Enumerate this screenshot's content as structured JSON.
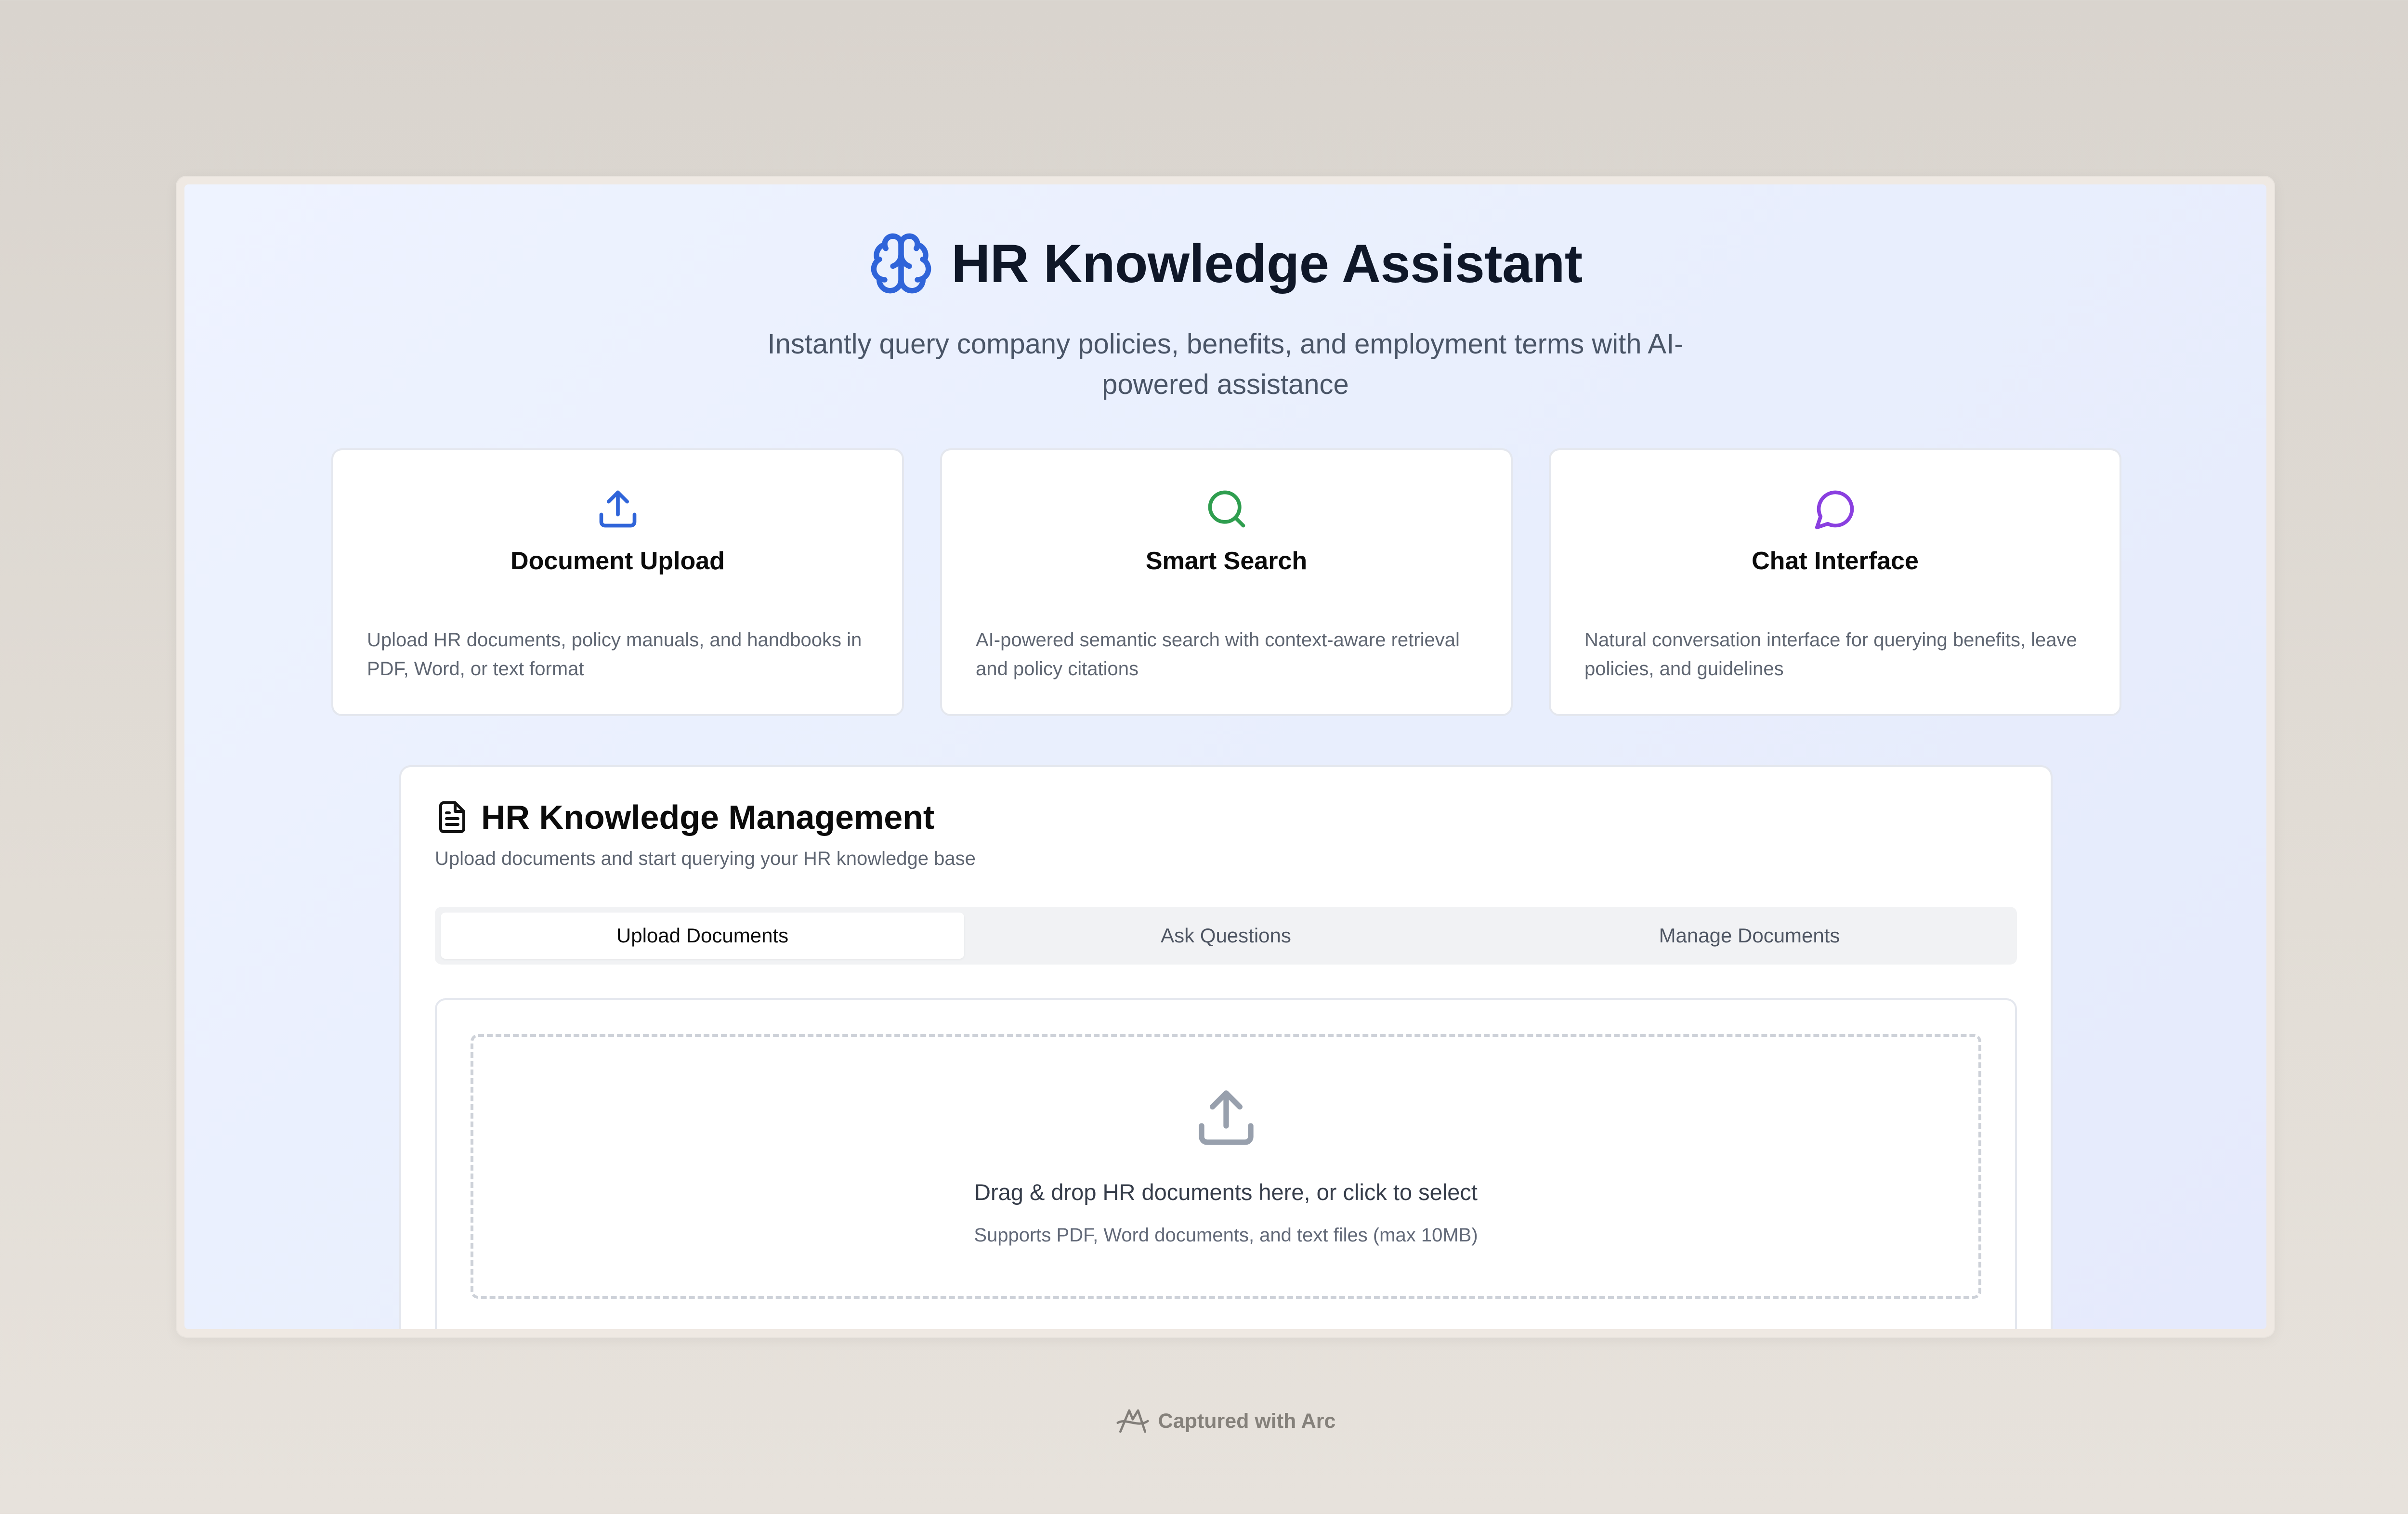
{
  "header": {
    "title": "HR Knowledge Assistant",
    "subtitle": "Instantly query company policies, benefits, and employment terms with AI-powered assistance",
    "icon": "brain-icon"
  },
  "features": [
    {
      "icon": "upload-icon",
      "color": "#2f64d9",
      "title": "Document Upload",
      "description": "Upload HR documents, policy manuals, and handbooks in PDF, Word, or text format"
    },
    {
      "icon": "search-icon",
      "color": "#2f9e4f",
      "title": "Smart Search",
      "description": "AI-powered semantic search with context-aware retrieval and policy citations"
    },
    {
      "icon": "chat-bubble-icon",
      "color": "#8a3fe0",
      "title": "Chat Interface",
      "description": "Natural conversation interface for querying benefits, leave policies, and guidelines"
    }
  ],
  "panel": {
    "title": "HR Knowledge Management",
    "subtitle": "Upload documents and start querying your HR knowledge base",
    "tabs": [
      {
        "label": "Upload Documents",
        "active": true
      },
      {
        "label": "Ask Questions",
        "active": false
      },
      {
        "label": "Manage Documents",
        "active": false
      }
    ],
    "dropzone": {
      "title": "Drag & drop HR documents here, or click to select",
      "subtitle": "Supports PDF, Word documents, and text files (max 10MB)"
    }
  },
  "footer": {
    "text": "Captured with Arc"
  },
  "colors": {
    "accent_blue": "#2f64d9",
    "accent_green": "#2f9e4f",
    "accent_purple": "#8a3fe0"
  }
}
